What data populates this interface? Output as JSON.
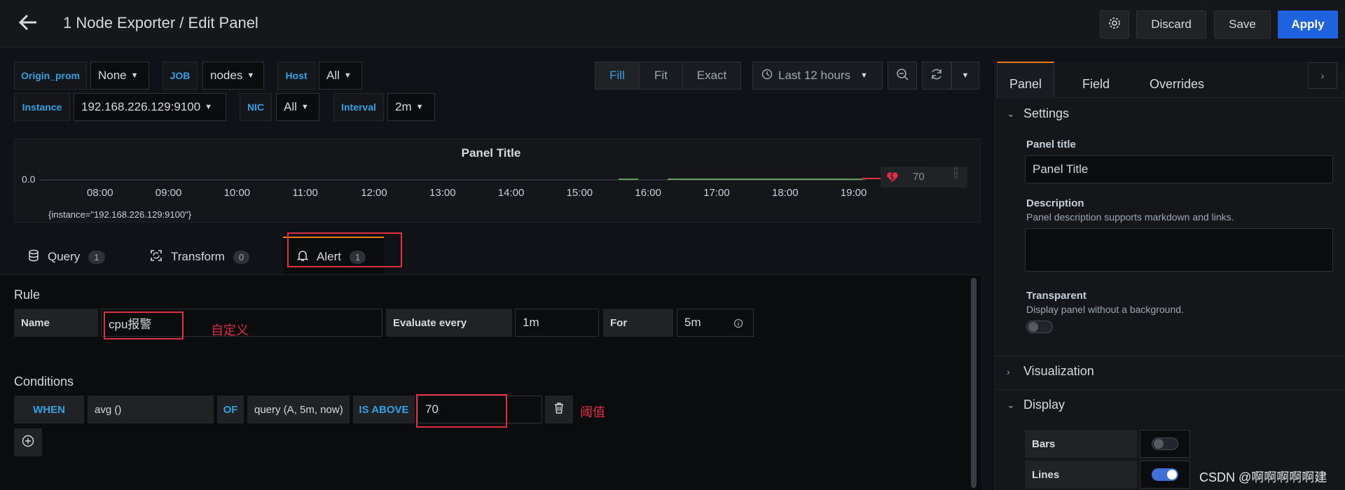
{
  "header": {
    "title": "1 Node Exporter / Edit Panel",
    "discard": "Discard",
    "save": "Save",
    "apply": "Apply"
  },
  "variables": [
    {
      "label": "Origin_prom",
      "value": "None"
    },
    {
      "label": "JOB",
      "value": "nodes"
    },
    {
      "label": "Host",
      "value": "All"
    },
    {
      "label": "Instance",
      "value": "192.168.226.129:9100"
    },
    {
      "label": "NIC",
      "value": "All"
    },
    {
      "label": "Interval",
      "value": "2m"
    }
  ],
  "toolbar": {
    "fill": "Fill",
    "fit": "Fit",
    "exact": "Exact",
    "time_range": "Last 12 hours"
  },
  "graph": {
    "title": "Panel Title",
    "y_tick": "0.0",
    "x_ticks": [
      "08:00",
      "09:00",
      "10:00",
      "11:00",
      "12:00",
      "13:00",
      "14:00",
      "15:00",
      "16:00",
      "17:00",
      "18:00",
      "19:00"
    ],
    "threshold_value": "70",
    "legend": "{instance=\"192.168.226.129:9100\"}"
  },
  "query_tabs": [
    {
      "label": "Query",
      "count": "1"
    },
    {
      "label": "Transform",
      "count": "0"
    },
    {
      "label": "Alert",
      "count": "1"
    }
  ],
  "rule": {
    "section": "Rule",
    "name_label": "Name",
    "name_value": "cpu报警",
    "evaluate_label": "Evaluate every",
    "evaluate_value": "1m",
    "for_label": "For",
    "for_value": "5m",
    "note": "自定义"
  },
  "conditions": {
    "section": "Conditions",
    "when": "WHEN",
    "reducer": "avg ()",
    "of": "OF",
    "query": "query (A, 5m, now)",
    "evaluator": "IS ABOVE",
    "threshold": "70",
    "note": "阈值"
  },
  "options": {
    "tabs": [
      "Panel",
      "Field",
      "Overrides"
    ],
    "settings": "Settings",
    "panel_title_label": "Panel title",
    "panel_title_value": "Panel Title",
    "description_label": "Description",
    "description_hint": "Panel description supports markdown and links.",
    "transparent_label": "Transparent",
    "transparent_hint": "Display panel without a background.",
    "visualization": "Visualization",
    "display": "Display",
    "bars_label": "Bars",
    "lines_label": "Lines",
    "bars_on": false,
    "lines_on": true
  },
  "watermark": "CSDN @啊啊啊啊啊建",
  "colors": {
    "accent": "#33a2e5",
    "apply": "#1f62e0",
    "annotation": "#e02f44",
    "series": "#73bf69"
  }
}
